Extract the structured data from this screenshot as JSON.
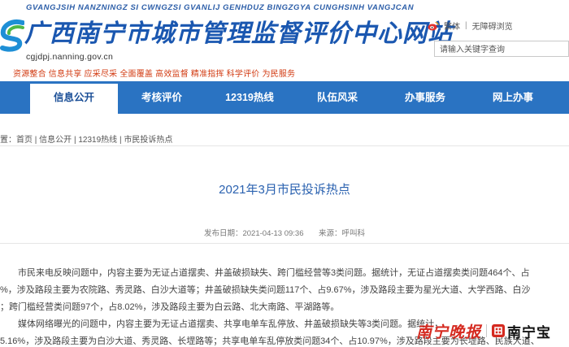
{
  "header": {
    "pinyin": "GVANGJSIH NANZNINGZ SI CWNGZSI GVANLIJ GENHDUZ BINGZGYA CUNGHSINH VANGJCAN",
    "title": "广西南宁市城市管理监督评价中心网站",
    "url": "cgjdpj.nanning.gov.cn",
    "slogans": "资源整合 信息共享 应采尽采 全面覆盖 高效监督 精准指挥 科学评价 为民服务",
    "top_links": [
      "繁体",
      "无障碍浏览"
    ],
    "search_placeholder": "请输入关键字查询"
  },
  "nav": {
    "items": [
      "信息公开",
      "考核评价",
      "12319热线",
      "队伍风采",
      "办事服务",
      "网上办事"
    ],
    "active_index": 0
  },
  "breadcrumb": {
    "prefix": "置：",
    "items": [
      "首页",
      "信息公开",
      "12319热线",
      "市民投诉热点"
    ],
    "separator": "|"
  },
  "article": {
    "title": "2021年3月市民投诉热点",
    "publish_label": "发布日期：",
    "publish_date": "2021-04-13 09:36",
    "source_label": "来源：",
    "source": "呼叫科",
    "lines": [
      "市民来电反映问题中，内容主要为无证占道摆卖、井盖破损缺失、跨门槛经营等3类问题。据统计，无证占道摆卖类问题464个、占",
      "%，涉及路段主要为农院路、秀灵路、白沙大道等；井盖破损缺失类问题117个、占9.67%，涉及路段主要为星光大道、大学西路、白沙",
      "；跨门槛经营类问题97个，占8.02%，涉及路段主要为白云路、北大南路、平湖路等。",
      "媒体网络曝光的问题中，内容主要为无证占道摆卖、共享电单车乱停放、井盖破损缺失等3类问题。据统计，",
      "5.16%，涉及路段主要为白沙大道、秀灵路、长堽路等；共享电单车乱停放类问题34个、占10.97%，涉及路段主要为长堽路、民族大道、"
    ]
  },
  "watermark": {
    "calligraphy": "南宁晚报",
    "brand": "南宁宝"
  },
  "colors": {
    "nav_bg": "#2a73c2",
    "title_blue": "#1a57b0",
    "slogan_red": "#d23b12",
    "article_title": "#2b62b0"
  }
}
